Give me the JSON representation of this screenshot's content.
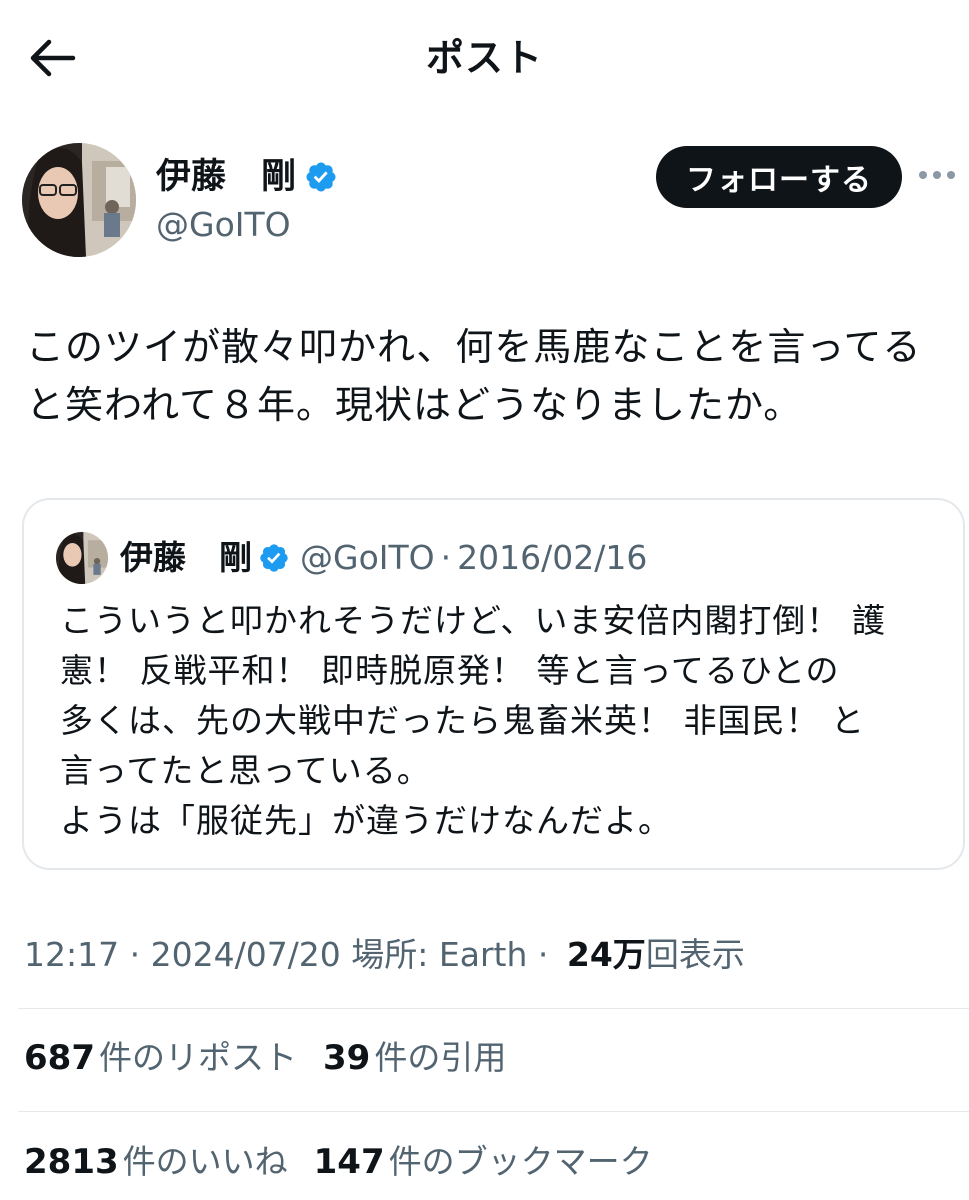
{
  "header": {
    "title": "ポスト",
    "back_icon": "arrow-left-icon"
  },
  "author": {
    "name": "伊藤　剛",
    "handle": "@GoITO",
    "verified_icon": "verified-badge-icon",
    "follow_label": "フォローする",
    "more_icon": "more-horizontal-icon"
  },
  "post": {
    "text": "このツイが散々叩かれ、何を馬鹿なことを言ってる\nと笑われて８年。現状はどうなりましたか。"
  },
  "quote": {
    "name": "伊藤　剛",
    "handle": "@GoITO",
    "separator": "·",
    "date": "2016/02/16",
    "text": "こういうと叩かれそうだけど、いま安倍内閣打倒！ 護\n憲！ 反戦平和！ 即時脱原発！ 等と言ってるひとの\n多くは、先の大戦中だったら鬼畜米英！ 非国民！ と\n言ってたと思っている。\nようは「服従先」が違うだけなんだよ。"
  },
  "meta": {
    "time": "12:17",
    "separator1": " · ",
    "date": "2024/07/20",
    "location": " 場所: Earth",
    "separator2": " · ",
    "views_count": "24万",
    "views_label": "回表示"
  },
  "stats": {
    "reposts": {
      "count": "687",
      "label": "件のリポスト"
    },
    "quotes": {
      "count": "39",
      "label": "件の引用"
    },
    "likes": {
      "count": "2813",
      "label": "件のいいね"
    },
    "bookmarks": {
      "count": "147",
      "label": "件のブックマーク"
    }
  },
  "colors": {
    "text_primary": "#0f1419",
    "text_secondary": "#536471",
    "verified_blue": "#1d9bf0",
    "border": "#e4e8eb",
    "follow_bg": "#0f1419"
  }
}
